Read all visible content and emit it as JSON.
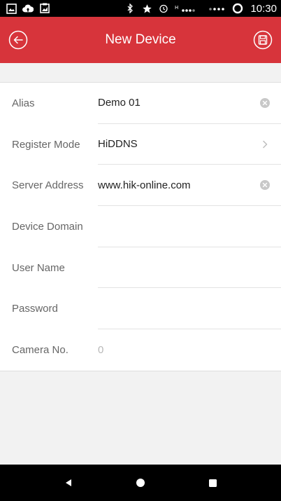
{
  "status_bar": {
    "time": "10:30",
    "left_icons": [
      "image-icon",
      "cloud-upload-icon",
      "gallery-icon"
    ],
    "right_icons": [
      "bluetooth-icon",
      "star-icon",
      "alarm-icon",
      "signal-icon",
      "wifi-icon",
      "battery-icon"
    ]
  },
  "header": {
    "title": "New Device",
    "background": "#d7343b"
  },
  "form": {
    "rows": [
      {
        "label": "Alias",
        "value": "Demo 01",
        "accessory": "clear"
      },
      {
        "label": "Register Mode",
        "value": "HiDDNS",
        "accessory": "chevron"
      },
      {
        "label": "Server Address",
        "value": "www.hik-online.com",
        "accessory": "clear"
      },
      {
        "label": "Device Domain",
        "value": "",
        "accessory": "none"
      },
      {
        "label": "User Name",
        "value": "",
        "accessory": "none"
      },
      {
        "label": "Password",
        "value": "",
        "accessory": "none"
      },
      {
        "label": "Camera No.",
        "value": "0",
        "accessory": "none"
      }
    ]
  },
  "nav_bar": {
    "buttons": [
      "back-triangle-icon",
      "home-circle-icon",
      "recents-square-icon"
    ]
  }
}
